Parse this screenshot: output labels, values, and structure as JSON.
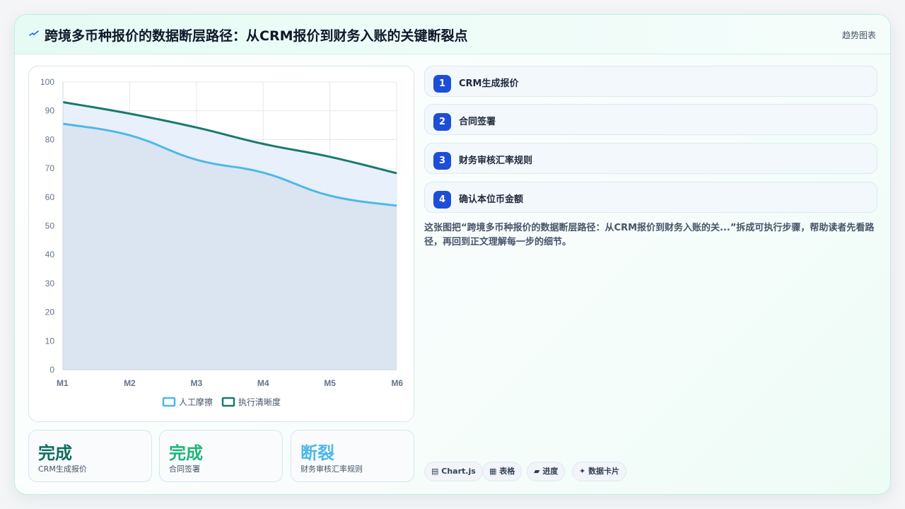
{
  "header": {
    "icon": "chart-bolt-icon",
    "title": "跨境多币种报价的数据断层路径：从CRM报价到财务入账的关键断裂点",
    "tag": "趋势图表"
  },
  "chart_data": {
    "type": "area",
    "categories": [
      "M1",
      "M2",
      "M3",
      "M4",
      "M5",
      "M6"
    ],
    "ylim": [
      0,
      100
    ],
    "yticks": [
      0,
      10,
      20,
      30,
      40,
      50,
      60,
      70,
      80,
      90,
      100
    ],
    "grid": true,
    "legend_position": "bottom",
    "series": [
      {
        "name": "人工摩擦",
        "values": [
          85.5,
          81.5,
          73,
          68.5,
          60.5,
          57
        ],
        "color": "#4fb8e6",
        "fill": "#d9e3ef"
      },
      {
        "name": "执行清晰度",
        "values": [
          93,
          89,
          84.2,
          78.5,
          74,
          68.3
        ],
        "color": "#1a7a6a",
        "fill": "#e6eefb"
      }
    ]
  },
  "stats": [
    {
      "value": "完成",
      "label": "CRM生成报价",
      "color": "#0f6e5c"
    },
    {
      "value": "完成",
      "label": "合同签署",
      "color": "#1fb578"
    },
    {
      "value": "断裂",
      "label": "财务审核汇率规则",
      "color": "#4fb8e6"
    }
  ],
  "steps": [
    {
      "num": "1",
      "label": "CRM生成报价"
    },
    {
      "num": "2",
      "label": "合同签署"
    },
    {
      "num": "3",
      "label": "财务审核汇率规则"
    },
    {
      "num": "4",
      "label": "确认本位币金额"
    }
  ],
  "description": "这张图把“跨境多币种报价的数据断层路径：从CRM报价到财务入账的关...”拆成可执行步骤，帮助读者先看路径，再回到正文理解每一步的细节。",
  "pills": [
    {
      "icon": "chart-icon",
      "glyph": "▤",
      "label": "Chart.js"
    },
    {
      "icon": "table-icon",
      "glyph": "▦",
      "label": "表格"
    },
    {
      "icon": "progress-icon",
      "glyph": "▰",
      "label": "进度"
    },
    {
      "icon": "sparkle-icon",
      "glyph": "✦",
      "label": "数据卡片"
    }
  ]
}
